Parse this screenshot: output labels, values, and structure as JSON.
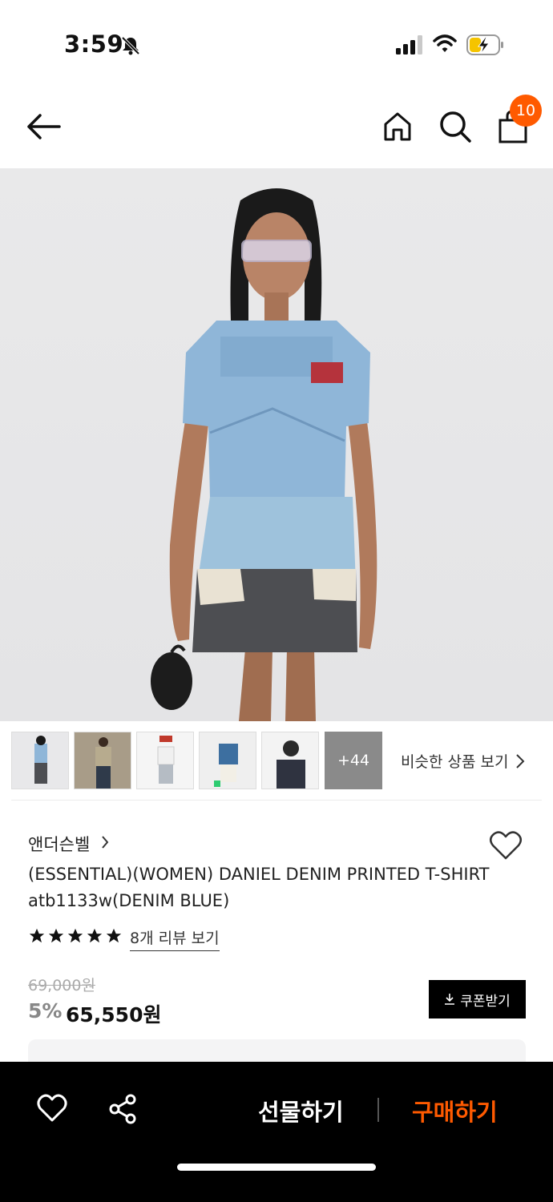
{
  "status_bar": {
    "time": "3:59",
    "icons": [
      "bell-slash-icon",
      "signal-icon",
      "wifi-icon",
      "battery-charging-icon"
    ]
  },
  "header": {
    "icons": [
      "back-icon",
      "home-icon",
      "search-icon",
      "cart-icon"
    ],
    "cart_count": "10"
  },
  "gallery": {
    "more_count": "+44",
    "similar_label": "비슷한 상품 보기"
  },
  "product": {
    "brand": "앤더슨벨",
    "title": "(ESSENTIAL)(WOMEN) DANIEL DENIM PRINTED T-SHIRT atb1133w(DENIM BLUE)",
    "rating_stars": 5,
    "review_link": "8개 리뷰 보기",
    "original_price": "69,000원",
    "discount": "5%",
    "sale_price": "65,550원",
    "coupon_label": "쿠폰받기"
  },
  "bottom_bar": {
    "gift_label": "선물하기",
    "buy_label": "구매하기"
  },
  "colors": {
    "accent": "#ff5a00",
    "bar_bg": "#000000"
  }
}
